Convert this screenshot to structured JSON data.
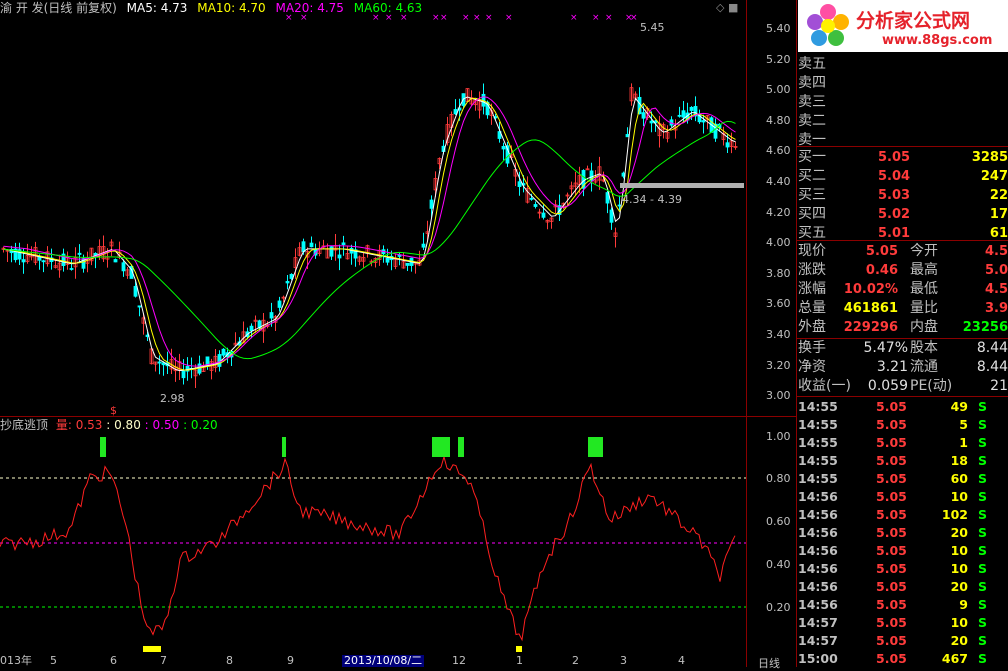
{
  "header": {
    "stock": "渝 开 发(日线 前复权)",
    "ma5": "MA5: 4.73",
    "ma10": "MA10: 4.70",
    "ma20": "MA20: 4.75",
    "ma60": "MA60: 4.63",
    "markers": "◇ ■"
  },
  "colors": {
    "up": "#ff3b3b",
    "down": "#00ffff",
    "ma5": "#ffffff",
    "ma10": "#ffff00",
    "ma20": "#ff00ff",
    "ma60": "#00ff00",
    "grid": "#8b0000"
  },
  "price_axis": [
    "5.40",
    "5.20",
    "5.00",
    "4.80",
    "4.60",
    "4.40",
    "4.20",
    "4.00",
    "3.80",
    "3.60",
    "3.40",
    "3.20",
    "3.00"
  ],
  "annotations": {
    "high": "5.45",
    "low": "2.98",
    "range": "4.34 - 4.39",
    "dollar": "$"
  },
  "indicator": {
    "name": "抄底逃顶",
    "vol_label": "量: 0.53",
    "v1": ": 0.80",
    "v2": ": 0.50",
    "v3": ": 0.20",
    "axis": [
      "1.00",
      "0.80",
      "0.60",
      "0.40",
      "0.20"
    ]
  },
  "date_axis": {
    "labels": [
      "013年",
      "5",
      "6",
      "7",
      "8",
      "9",
      "2013/10/08/二",
      "12",
      "1",
      "2",
      "3",
      "4"
    ],
    "right": "日线"
  },
  "logo": {
    "brand": "分析家公式网",
    "url": "www.88gs.com"
  },
  "order_book": {
    "sell": [
      {
        "label": "卖五"
      },
      {
        "label": "卖四"
      },
      {
        "label": "卖三"
      },
      {
        "label": "卖二"
      },
      {
        "label": "卖一"
      }
    ],
    "buy": [
      {
        "label": "买一",
        "price": "5.05",
        "vol": "3285"
      },
      {
        "label": "买二",
        "price": "5.04",
        "vol": "247"
      },
      {
        "label": "买三",
        "price": "5.03",
        "vol": "22"
      },
      {
        "label": "买四",
        "price": "5.02",
        "vol": "17"
      },
      {
        "label": "买五",
        "price": "5.01",
        "vol": "61"
      }
    ]
  },
  "quote": [
    {
      "l1": "现价",
      "v1": "5.05",
      "l2": "今开",
      "v2": "4.5"
    },
    {
      "l1": "涨跌",
      "v1": "0.46",
      "l2": "最高",
      "v2": "5.0"
    },
    {
      "l1": "涨幅",
      "v1": "10.02%",
      "l2": "最低",
      "v2": "4.5"
    },
    {
      "l1": "总量",
      "v1": "461861",
      "l2": "量比",
      "v2": "3.9"
    },
    {
      "l1": "外盘",
      "v1": "229296",
      "l2": "内盘",
      "v2": "23256"
    }
  ],
  "fundamentals": [
    {
      "l1": "换手",
      "v1": "5.47%",
      "l2": "股本",
      "v2": "8.44"
    },
    {
      "l1": "净资",
      "v1": "3.21",
      "l2": "流通",
      "v2": "8.44"
    },
    {
      "l1": "收益(一)",
      "v1": "0.059",
      "l2": "PE(动)",
      "v2": "21"
    }
  ],
  "ticks": [
    {
      "t": "14:55",
      "p": "5.05",
      "v": "49",
      "s": "S"
    },
    {
      "t": "14:55",
      "p": "5.05",
      "v": "5",
      "s": "S"
    },
    {
      "t": "14:55",
      "p": "5.05",
      "v": "1",
      "s": "S"
    },
    {
      "t": "14:55",
      "p": "5.05",
      "v": "18",
      "s": "S"
    },
    {
      "t": "14:55",
      "p": "5.05",
      "v": "60",
      "s": "S"
    },
    {
      "t": "14:56",
      "p": "5.05",
      "v": "10",
      "s": "S"
    },
    {
      "t": "14:56",
      "p": "5.05",
      "v": "102",
      "s": "S"
    },
    {
      "t": "14:56",
      "p": "5.05",
      "v": "20",
      "s": "S"
    },
    {
      "t": "14:56",
      "p": "5.05",
      "v": "10",
      "s": "S"
    },
    {
      "t": "14:56",
      "p": "5.05",
      "v": "10",
      "s": "S"
    },
    {
      "t": "14:56",
      "p": "5.05",
      "v": "20",
      "s": "S"
    },
    {
      "t": "14:56",
      "p": "5.05",
      "v": "9",
      "s": "S"
    },
    {
      "t": "14:57",
      "p": "5.05",
      "v": "10",
      "s": "S"
    },
    {
      "t": "14:57",
      "p": "5.05",
      "v": "20",
      "s": "S"
    },
    {
      "t": "15:00",
      "p": "5.05",
      "v": "467",
      "s": "S"
    }
  ]
}
